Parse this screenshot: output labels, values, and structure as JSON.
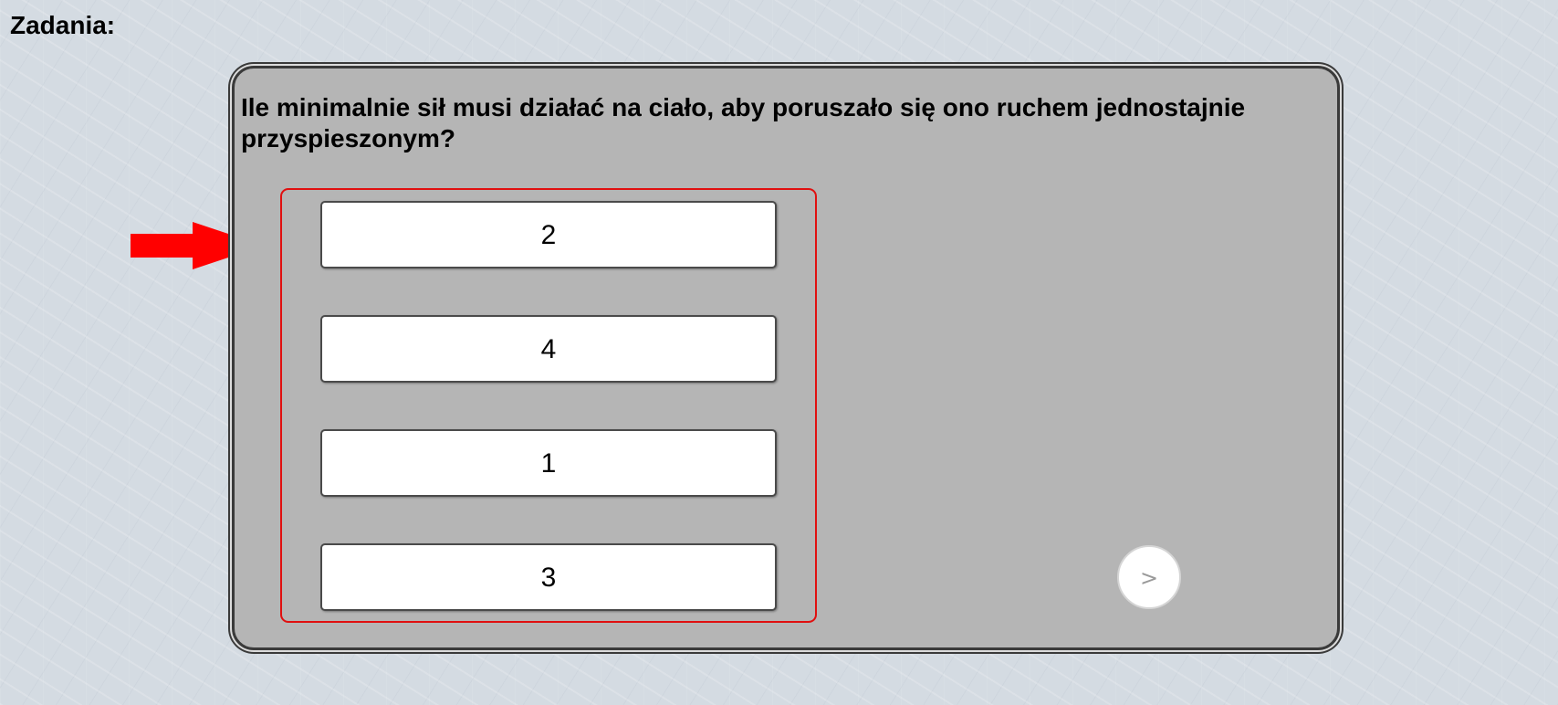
{
  "section_title": "Zadania:",
  "quiz": {
    "question": "Ile minimalnie sił musi działać na ciało, aby poruszało się ono ruchem jednostajnie przyspieszonym?",
    "answers": [
      {
        "label": "2"
      },
      {
        "label": "4"
      },
      {
        "label": "1"
      },
      {
        "label": "3"
      }
    ],
    "next_label": ">"
  },
  "colors": {
    "highlight": "#e01010",
    "panel_background": "#b5b5b5",
    "arrow": "#ff0000"
  },
  "icons": {
    "pointer": "red-arrow-right-icon"
  }
}
